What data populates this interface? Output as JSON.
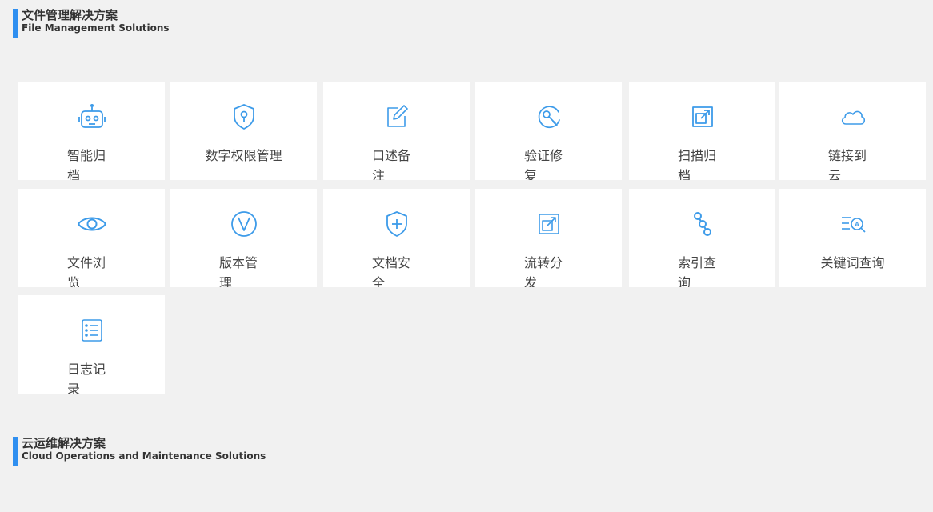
{
  "section1": {
    "title": "文件管理解决方案",
    "subtitle": "File Management Solutions"
  },
  "section2": {
    "title": "云运维解决方案",
    "subtitle": "Cloud Operations and Maintenance Solutions"
  },
  "accent_color": "#2f8ff0",
  "icon_color": "#3d9be9",
  "features": [
    {
      "label": "智能归档",
      "icon": "robot-icon"
    },
    {
      "label": "数字权限管理",
      "icon": "shield-key-icon"
    },
    {
      "label": "口述备注",
      "icon": "edit-note-icon"
    },
    {
      "label": "验证修复",
      "icon": "repair-tool-icon"
    },
    {
      "label": "扫描归档",
      "icon": "scan-export-icon"
    },
    {
      "label": "链接到云",
      "icon": "cloud-icon"
    },
    {
      "label": "文件浏览",
      "icon": "eye-icon"
    },
    {
      "label": "版本管理",
      "icon": "version-v-icon"
    },
    {
      "label": "文档安全",
      "icon": "shield-plus-icon"
    },
    {
      "label": "流转分发",
      "icon": "share-export-icon"
    },
    {
      "label": "索引查询",
      "icon": "index-nodes-icon"
    },
    {
      "label": "关键词查询",
      "icon": "keyword-search-icon"
    },
    {
      "label": "日志记录",
      "icon": "log-list-icon"
    }
  ]
}
